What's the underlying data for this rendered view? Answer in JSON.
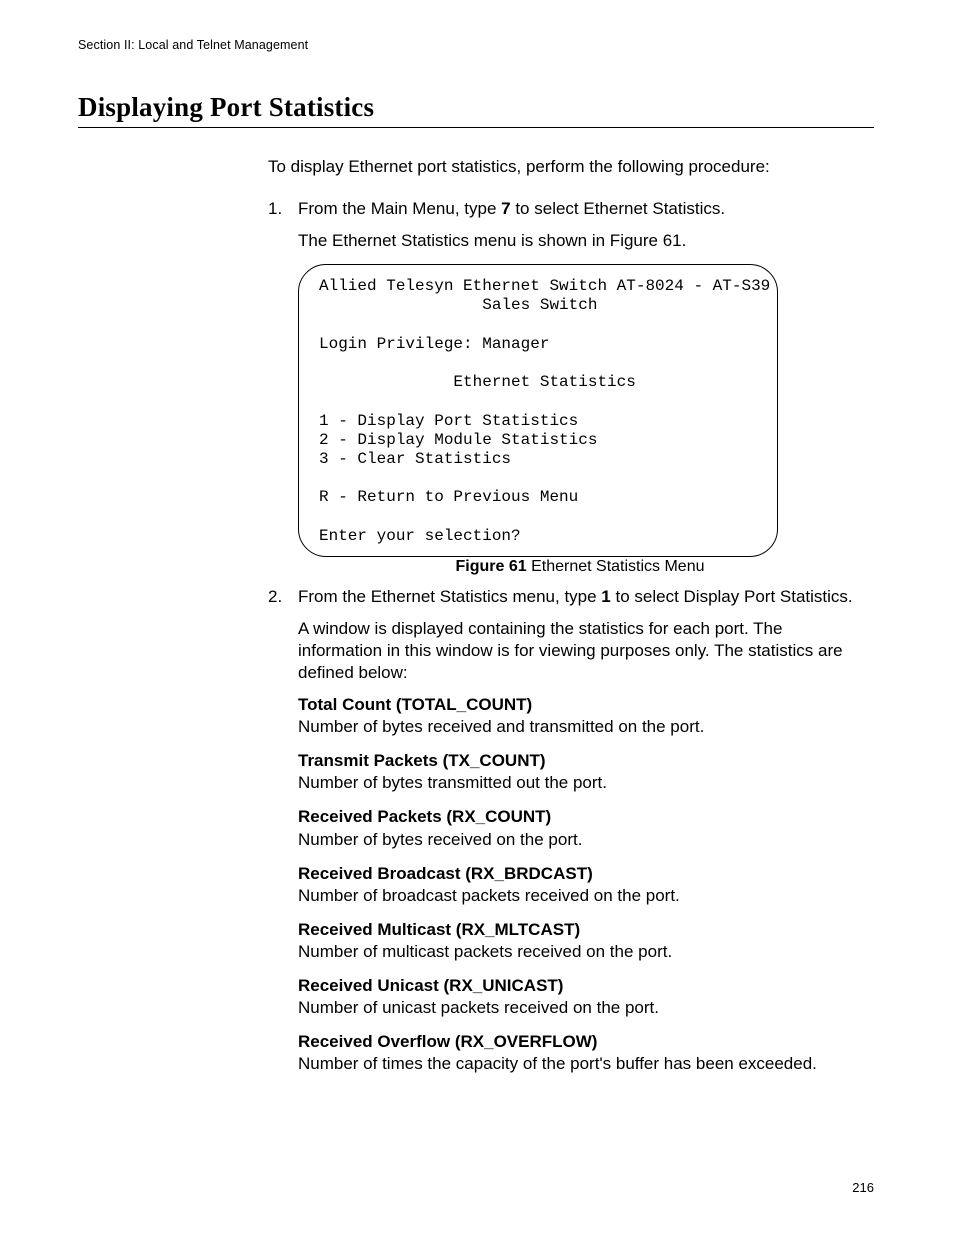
{
  "running_head": "Section II: Local and Telnet Management",
  "h1": "Displaying Port Statistics",
  "intro": "To display Ethernet port statistics, perform the following procedure:",
  "page_number": "216",
  "steps": {
    "s1": {
      "num": "1.",
      "line1_a": "From the Main Menu, type ",
      "line1_b": "7",
      "line1_c": " to select Ethernet Statistics.",
      "line2": "The Ethernet Statistics menu is shown in Figure 61."
    },
    "s2": {
      "num": "2.",
      "line1_a": "From the Ethernet Statistics menu, type ",
      "line1_b": "1",
      "line1_c": " to select Display Port Statistics.",
      "line2": "A window is displayed containing the statistics for each port. The information in this window is for viewing purposes only. The statistics are defined below:"
    }
  },
  "menu": {
    "title1": "Allied Telesyn Ethernet Switch AT-8024 - AT-S39",
    "title2": "Sales Switch",
    "login": "Login Privilege: Manager",
    "head": "Ethernet Statistics",
    "opt1": "1 - Display Port Statistics",
    "opt2": "2 - Display Module Statistics",
    "opt3": "3 - Clear Statistics",
    "optR": "R - Return to Previous Menu",
    "prompt": "Enter your selection?"
  },
  "figcap": {
    "label": "Figure 61",
    "rest": "  Ethernet Statistics Menu"
  },
  "defs": [
    {
      "term": "Total Count (TOTAL_COUNT)",
      "body": "Number of bytes received and transmitted on the port."
    },
    {
      "term": "Transmit Packets (TX_COUNT)",
      "body": "Number of bytes transmitted out the port."
    },
    {
      "term": "Received Packets (RX_COUNT)",
      "body": "Number of bytes received on the port."
    },
    {
      "term": "Received Broadcast (RX_BRDCAST)",
      "body": "Number of broadcast packets received on the port."
    },
    {
      "term": "Received Multicast (RX_MLTCAST)",
      "body": "Number of multicast packets received on the port."
    },
    {
      "term": "Received Unicast (RX_UNICAST)",
      "body": "Number of unicast packets received on the port."
    },
    {
      "term": "Received Overflow (RX_OVERFLOW)",
      "body": "Number of times the capacity of the port's buffer has been exceeded."
    }
  ]
}
